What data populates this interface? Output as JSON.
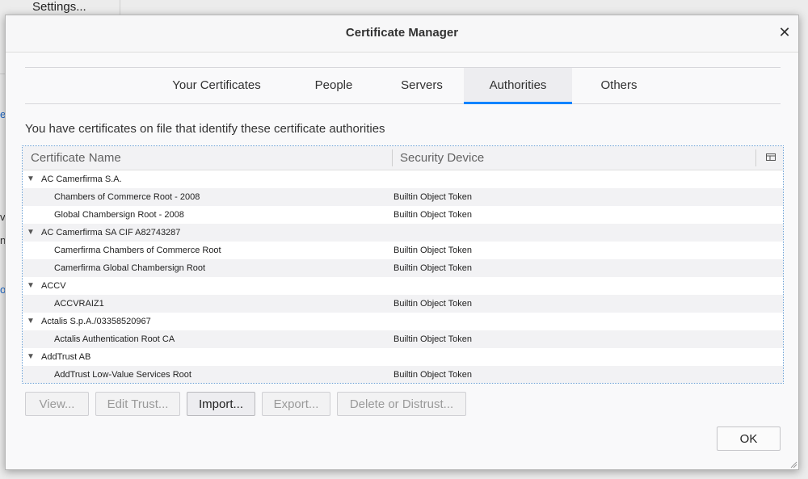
{
  "background": {
    "settings_label": "Settings...",
    "fragments": [
      "e",
      "v",
      "nf",
      "o"
    ]
  },
  "dialog": {
    "title": "Certificate Manager",
    "close_icon": "close-icon"
  },
  "tabs": [
    {
      "label": "Your Certificates",
      "active": false
    },
    {
      "label": "People",
      "active": false
    },
    {
      "label": "Servers",
      "active": false
    },
    {
      "label": "Authorities",
      "active": true
    },
    {
      "label": "Others",
      "active": false
    }
  ],
  "description": "You have certificates on file that identify these certificate authorities",
  "tree": {
    "columns": [
      "Certificate Name",
      "Security Device"
    ],
    "column_picker_icon": "column-picker-icon",
    "rows": [
      {
        "type": "group",
        "name": "AC Camerfirma S.A.",
        "device": ""
      },
      {
        "type": "cert",
        "name": "Chambers of Commerce Root - 2008",
        "device": "Builtin Object Token"
      },
      {
        "type": "cert",
        "name": "Global Chambersign Root - 2008",
        "device": "Builtin Object Token"
      },
      {
        "type": "group",
        "name": "AC Camerfirma SA CIF A82743287",
        "device": ""
      },
      {
        "type": "cert",
        "name": "Camerfirma Chambers of Commerce Root",
        "device": "Builtin Object Token"
      },
      {
        "type": "cert",
        "name": "Camerfirma Global Chambersign Root",
        "device": "Builtin Object Token"
      },
      {
        "type": "group",
        "name": "ACCV",
        "device": ""
      },
      {
        "type": "cert",
        "name": "ACCVRAIZ1",
        "device": "Builtin Object Token"
      },
      {
        "type": "group",
        "name": "Actalis S.p.A./03358520967",
        "device": ""
      },
      {
        "type": "cert",
        "name": "Actalis Authentication Root CA",
        "device": "Builtin Object Token"
      },
      {
        "type": "group",
        "name": "AddTrust AB",
        "device": ""
      },
      {
        "type": "cert",
        "name": "AddTrust Low-Value Services Root",
        "device": "Builtin Object Token"
      }
    ]
  },
  "buttons": [
    {
      "label": "View...",
      "enabled": false
    },
    {
      "label": "Edit Trust...",
      "enabled": false
    },
    {
      "label": "Import...",
      "enabled": true
    },
    {
      "label": "Export...",
      "enabled": false
    },
    {
      "label": "Delete or Distrust...",
      "enabled": false
    }
  ],
  "ok_label": "OK",
  "colors": {
    "accent": "#0a84ff"
  }
}
